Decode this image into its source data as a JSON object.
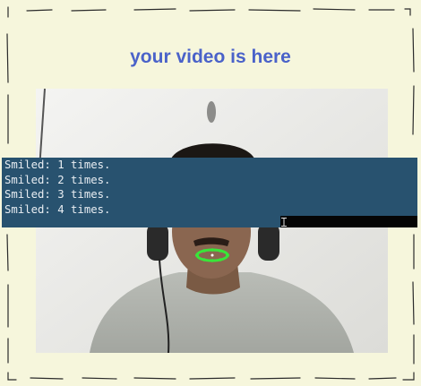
{
  "heading": "your video is here",
  "console": {
    "lines": [
      "Smiled: 1 times.",
      "Smiled: 2 times.",
      "Smiled: 3 times.",
      "Smiled: 4 times."
    ]
  },
  "colors": {
    "page_background": "#f6f6dc",
    "heading": "#4a62c9",
    "console_background": "#28526f",
    "lip_landmarks": "#39e639"
  },
  "icons": [
    "text-cursor-icon"
  ]
}
